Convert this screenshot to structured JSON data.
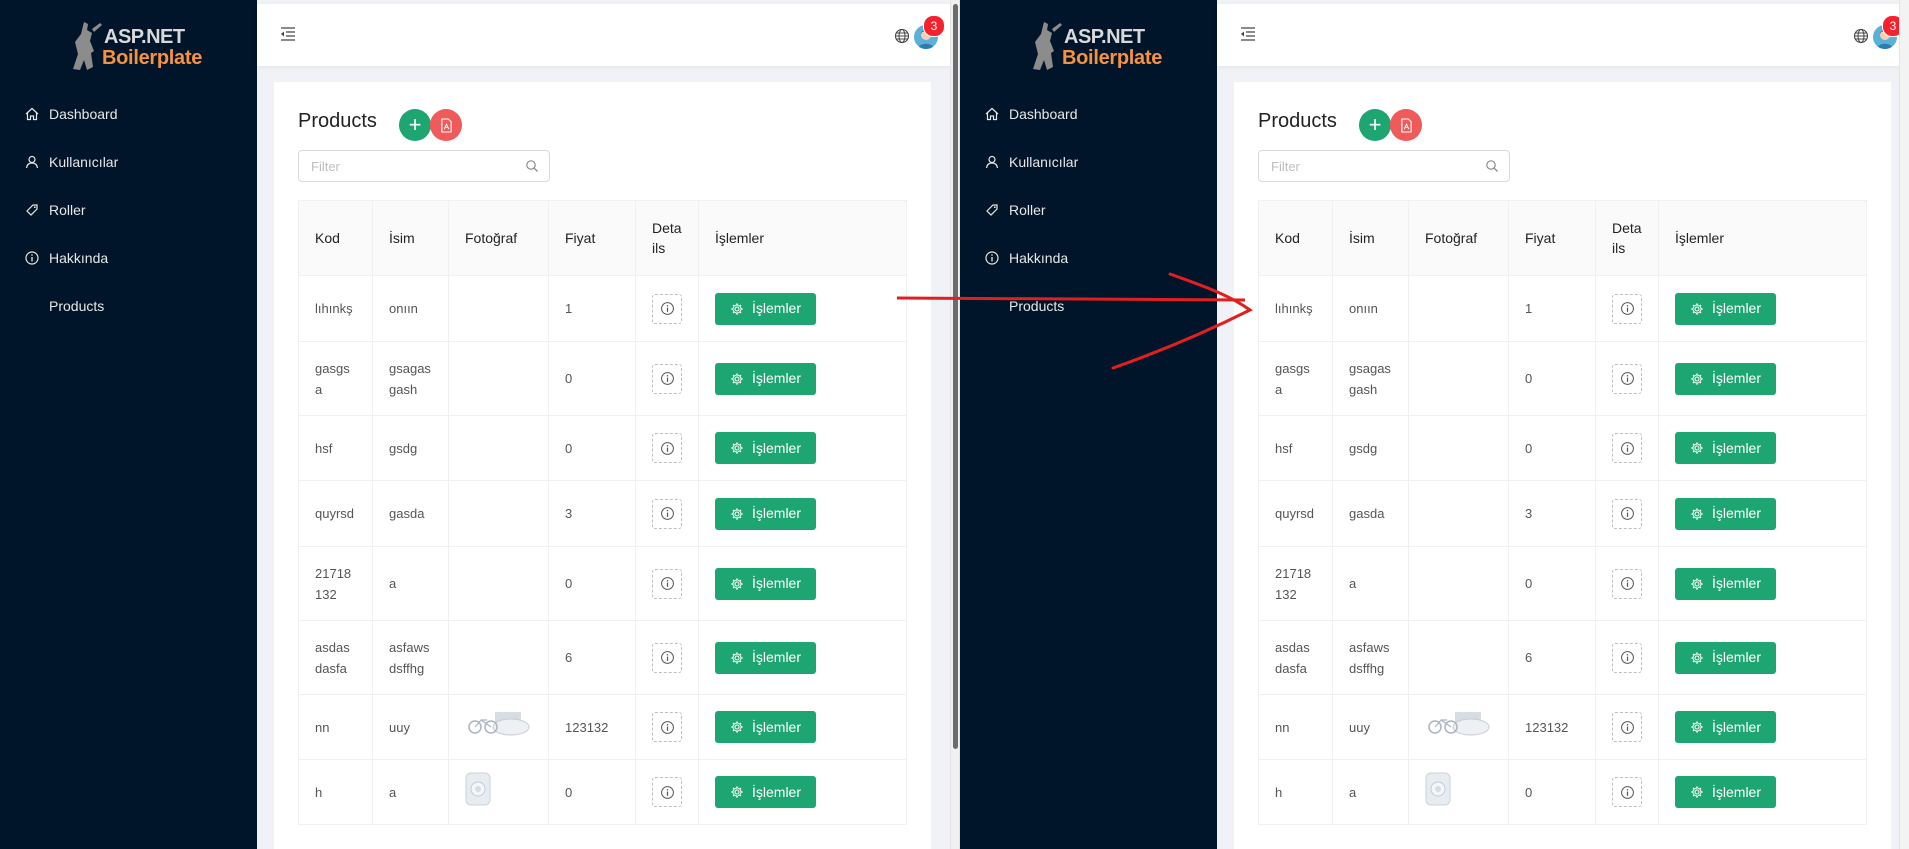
{
  "app": {
    "logo_line1": "ASP.NET",
    "logo_line2": "Boilerplate",
    "notification_count": "3"
  },
  "sidebar": {
    "items": [
      {
        "label": "Dashboard",
        "icon": "home-icon"
      },
      {
        "label": "Kullanıcılar",
        "icon": "user-icon"
      },
      {
        "label": "Roller",
        "icon": "tag-icon"
      },
      {
        "label": "Hakkında",
        "icon": "info-icon"
      },
      {
        "label": "Products",
        "icon": ""
      }
    ]
  },
  "page": {
    "title": "Products",
    "filter_placeholder": "Filter"
  },
  "table": {
    "columns": [
      "Kod",
      "İsim",
      "Fotoğraf",
      "Fiyat",
      "Details",
      "İşlemler"
    ],
    "action_label": "İşlemler",
    "rows": [
      {
        "kod": "lıhınkş",
        "isim": "onıın",
        "foto": "",
        "fiyat": "1"
      },
      {
        "kod": "gasgsa",
        "isim": "gsagasgash",
        "foto": "",
        "fiyat": "0"
      },
      {
        "kod": "hsf",
        "isim": "gsdg",
        "foto": "",
        "fiyat": "0"
      },
      {
        "kod": "quyrsd",
        "isim": "gasda",
        "foto": "",
        "fiyat": "3"
      },
      {
        "kod": "21718132",
        "isim": "a",
        "foto": "",
        "fiyat": "0"
      },
      {
        "kod": "asdasdasfa",
        "isim": "asfawsdsffhg",
        "foto": "",
        "fiyat": "6"
      },
      {
        "kod": "nn",
        "isim": "uuy",
        "foto": "bike",
        "fiyat": "123132"
      },
      {
        "kod": "h",
        "isim": "a",
        "foto": "device",
        "fiyat": "0"
      }
    ]
  },
  "colors": {
    "sidebar_bg": "#001529",
    "primary_green": "#1ea672",
    "danger_red": "#ef5b5b",
    "annotation_arrow": "#e02020",
    "logo_accent": "#f5923e"
  }
}
